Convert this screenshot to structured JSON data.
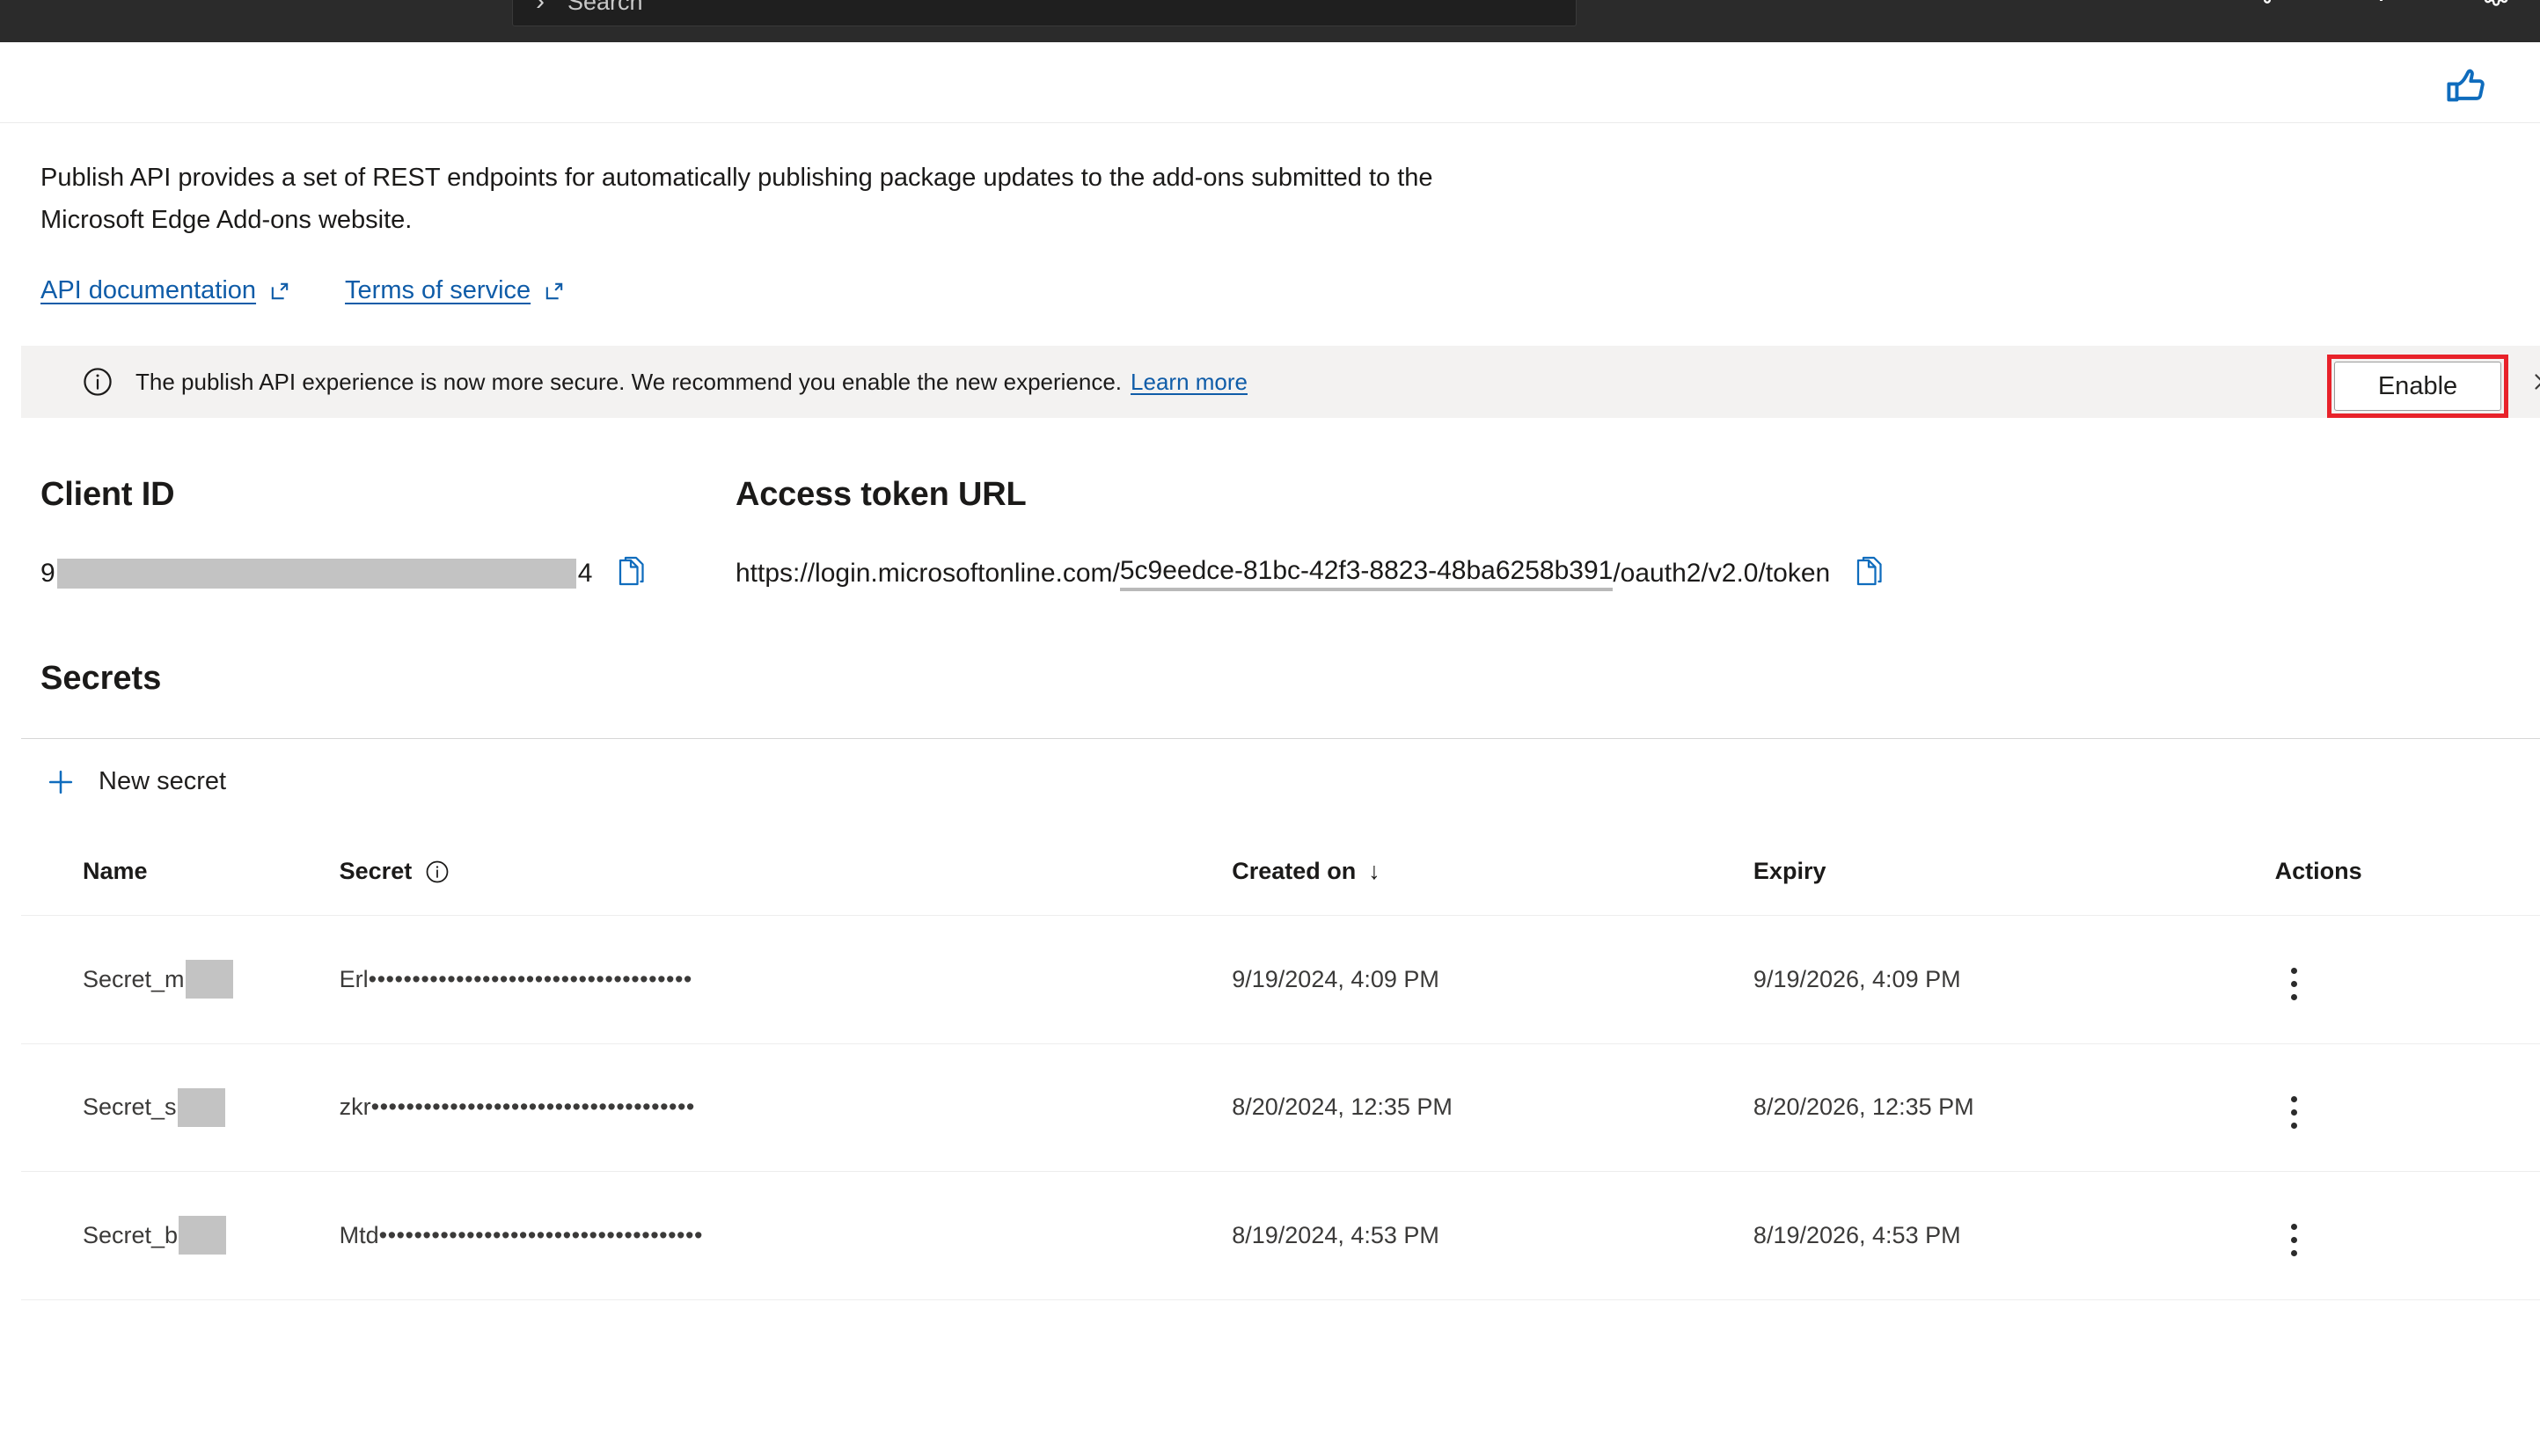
{
  "chrome": {
    "search_placeholder": "Search",
    "icons": {
      "search_chevron": "chevron-right-icon",
      "notifications": "bell-icon",
      "help": "?",
      "settings": "gear-icon"
    }
  },
  "feedback": {
    "icon": "thumbs-up-icon"
  },
  "intro": {
    "description": "Publish API provides a set of REST endpoints for automatically publishing package updates to the add-ons submitted to the Microsoft Edge Add-ons website.",
    "links": [
      {
        "label": "API documentation",
        "icon": "external-link-icon"
      },
      {
        "label": "Terms of service",
        "icon": "external-link-icon"
      }
    ]
  },
  "banner": {
    "icon": "info-circle-icon",
    "message": "The publish API experience is now more secure. We recommend you enable the new experience.",
    "link_label": "Learn more",
    "action_label": "Enable",
    "close_icon": "close-icon",
    "highlight_color": "#e8222a"
  },
  "client_id": {
    "title": "Client ID",
    "prefix": "9",
    "suffix": "4",
    "redacted": true,
    "copy_icon": "copy-icon"
  },
  "access_token_url": {
    "title": "Access token URL",
    "prefix": "https://login.microsoftonline.com/",
    "guid": "5c9eedce-81bc-42f3-8823-48ba6258b391",
    "suffix": "/oauth2/v2.0/token",
    "copy_icon": "copy-icon"
  },
  "secrets": {
    "title": "Secrets",
    "new_secret_label": "New secret",
    "new_secret_icon": "plus-icon",
    "columns": {
      "name": "Name",
      "secret": "Secret",
      "secret_info_icon": "info-circle-icon",
      "created_on": "Created on",
      "sort_indicator": "↓",
      "expiry": "Expiry",
      "actions": "Actions"
    },
    "rows": [
      {
        "name_prefix": "Secret_m",
        "name_redacted": true,
        "secret_prefix": "Erl",
        "secret_mask": "•••••••••••••••••••••••••••••••••••••",
        "created_on": "9/19/2024, 4:09 PM",
        "expiry": "9/19/2026, 4:09 PM",
        "actions_icon": "more-vertical-icon"
      },
      {
        "name_prefix": "Secret_s",
        "name_redacted": true,
        "secret_prefix": "zkr",
        "secret_mask": "•••••••••••••••••••••••••••••••••••••",
        "created_on": "8/20/2024, 12:35 PM",
        "expiry": "8/20/2026, 12:35 PM",
        "actions_icon": "more-vertical-icon"
      },
      {
        "name_prefix": "Secret_b",
        "name_redacted": true,
        "secret_prefix": "Mtd",
        "secret_mask": "•••••••••••••••••••••••••••••••••••••",
        "created_on": "8/19/2024, 4:53 PM",
        "expiry": "8/19/2026, 4:53 PM",
        "actions_icon": "more-vertical-icon"
      }
    ]
  },
  "colors": {
    "link": "#0f5ca8",
    "banner_bg": "#f3f2f1",
    "highlight": "#e8222a",
    "chrome_bg": "#2b2b2b"
  }
}
